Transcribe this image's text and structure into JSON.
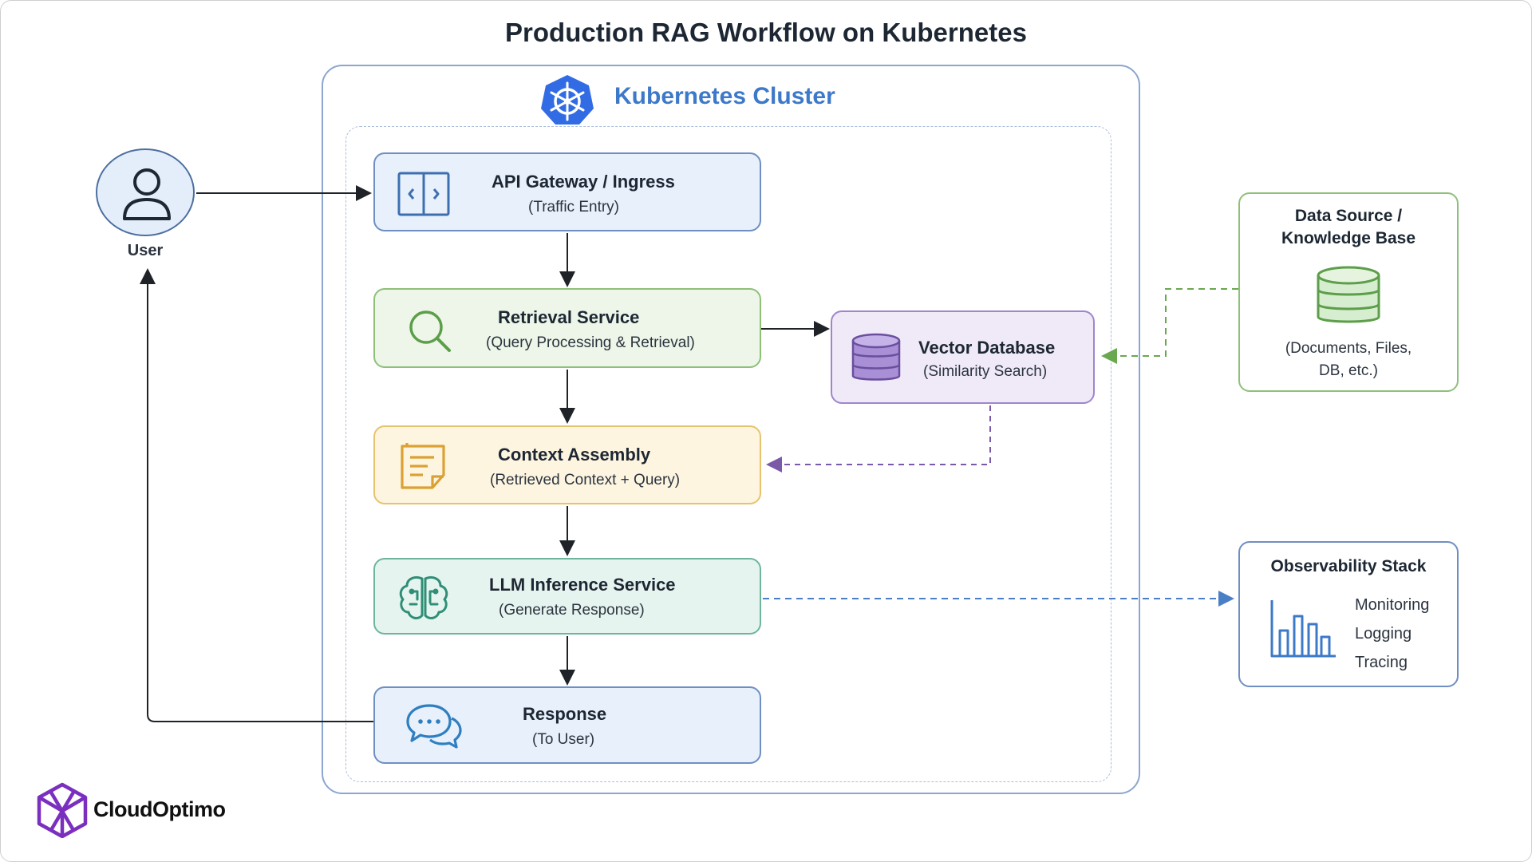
{
  "title": "Production RAG Workflow on Kubernetes",
  "cluster_label": "Kubernetes Cluster",
  "user_label": "User",
  "nodes": {
    "gateway": {
      "title": "API Gateway / Ingress",
      "subtitle": "(Traffic Entry)"
    },
    "retrieval": {
      "title": "Retrieval Service",
      "subtitle": "(Query Processing & Retrieval)"
    },
    "context": {
      "title": "Context Assembly",
      "subtitle": "(Retrieved Context + Query)"
    },
    "llm": {
      "title": "LLM Inference Service",
      "subtitle": "(Generate Response)"
    },
    "response": {
      "title": "Response",
      "subtitle": "(To User)"
    },
    "vector": {
      "title": "Vector Database",
      "subtitle": "(Similarity Search)"
    }
  },
  "datasource": {
    "title_line1": "Data Source /",
    "title_line2": "Knowledge Base",
    "desc_line1": "(Documents, Files,",
    "desc_line2": "DB, etc.)"
  },
  "observability": {
    "title": "Observability Stack",
    "items": [
      "Monitoring",
      "Logging",
      "Tracing"
    ]
  },
  "brand": "CloudOptimo",
  "colors": {
    "kubernetes_blue": "#326ce5",
    "data_flow_green": "#6aa84f",
    "vector_flow_purple": "#7a5aa8",
    "observability_blue": "#4a7fc8",
    "brand_purple": "#7b2fbf"
  },
  "icons": {
    "user": "user-icon",
    "gateway": "gateway-door-icon",
    "retrieval": "magnifier-icon",
    "context": "document-note-icon",
    "llm": "brain-circuit-icon",
    "response": "chat-bubbles-icon",
    "vector": "database-icon",
    "datasource": "database-icon",
    "observability": "bar-chart-icon",
    "kubernetes": "kubernetes-helm-icon",
    "brand": "cloudoptimo-logo"
  }
}
